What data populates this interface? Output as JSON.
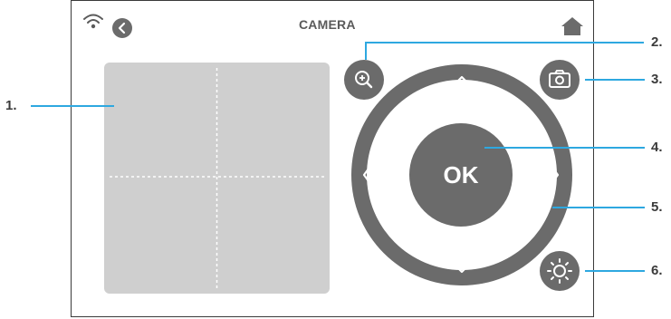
{
  "header": {
    "title": "CAMERA",
    "wifi_icon": "wifi-icon",
    "back_icon": "back-icon",
    "home_icon": "home-icon"
  },
  "controls": {
    "ok_label": "OK",
    "zoom_icon": "zoom-in-icon",
    "capture_icon": "camera-icon",
    "brightness_icon": "brightness-icon",
    "arrows": [
      "arrow-up-icon",
      "arrow-left-icon",
      "arrow-right-icon",
      "arrow-down-icon"
    ]
  },
  "callouts": {
    "c1": "1.",
    "c2": "2.",
    "c3": "3.",
    "c4": "4.",
    "c5": "5.",
    "c6": "6."
  },
  "colors": {
    "accent": "#2ea8e0",
    "button": "#6b6b6b",
    "preview_bg": "#cfcfcf"
  }
}
